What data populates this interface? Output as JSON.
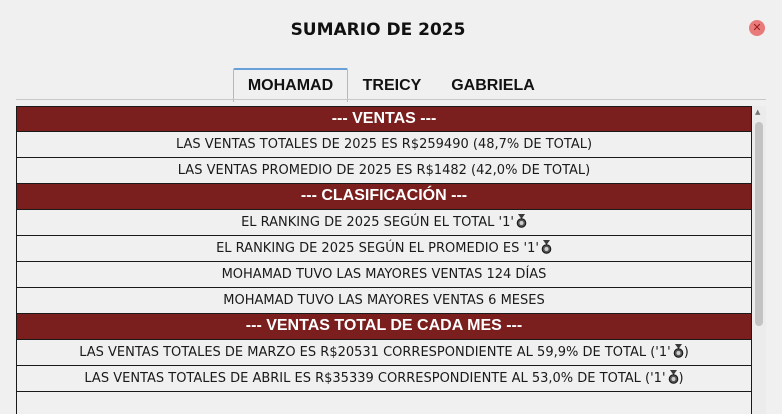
{
  "window": {
    "title": "SUMARIO DE 2025",
    "close_icon": "close-icon"
  },
  "tabs": [
    {
      "label": "MOHAMAD",
      "active": true
    },
    {
      "label": "TREICY",
      "active": false
    },
    {
      "label": "GABRIELA",
      "active": false
    }
  ],
  "colors": {
    "header_bg": "#7b1e1e",
    "header_text": "#ffffff",
    "tab_accent": "#6aa0d8"
  },
  "rows": {
    "h_ventas": "--- VENTAS ---",
    "r_total": "LAS VENTAS TOTALES DE 2025 ES R$259490 (48,7% DE TOTAL)",
    "r_promedio": "LAS VENTAS PROMEDIO DE 2025 ES R$1482 (42,0% DE TOTAL)",
    "h_clasificacion": "--- CLASIFICACIÓN ---",
    "r_rank_total": "EL RANKING DE 2025 SEGÚN EL TOTAL '1'",
    "r_rank_promedio": "EL RANKING DE 2025 SEGÚN EL PROMEDIO ES '1'",
    "r_dias": "MOHAMAD TUVO LAS MAYORES VENTAS 124 DÍAS",
    "r_meses": "MOHAMAD TUVO LAS MAYORES VENTAS 6 MESES",
    "h_mes": "--- VENTAS TOTAL DE CADA MES ---",
    "r_marzo_pre": "LAS VENTAS TOTALES DE MARZO ES R$20531 CORRESPONDIENTE AL 59,9% DE TOTAL ('1'",
    "r_marzo_post": ")",
    "r_abril_pre": "LAS VENTAS TOTALES DE ABRIL ES R$35339 CORRESPONDIENTE AL 53,0% DE TOTAL ('1'",
    "r_abril_post": ")",
    "medal_icon": "medal-icon"
  }
}
